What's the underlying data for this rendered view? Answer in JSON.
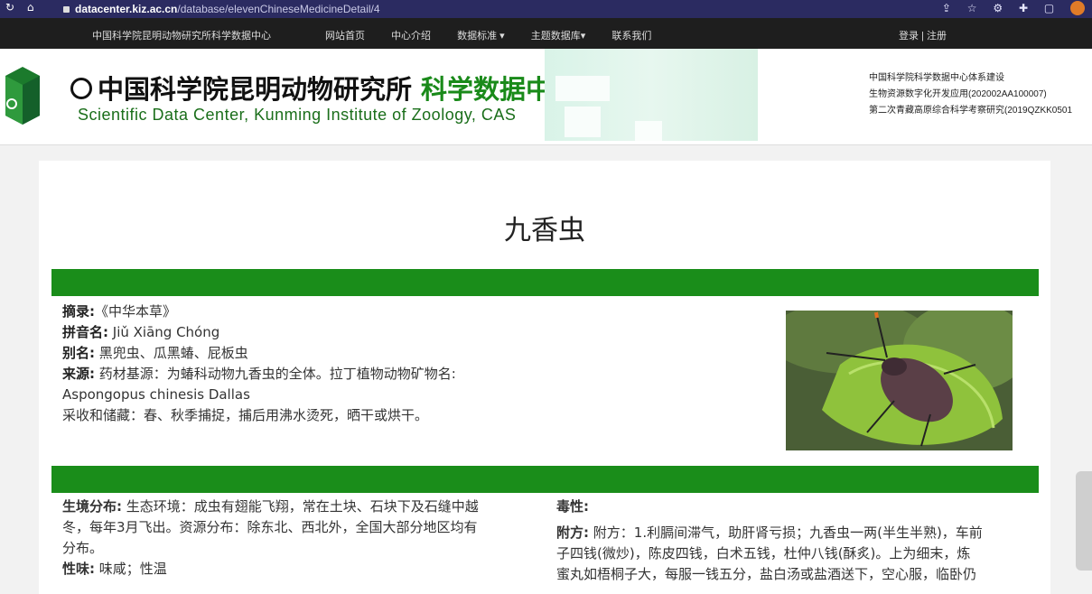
{
  "browser": {
    "host": "datacenter.kiz.ac.cn",
    "path": "/database/elevenChineseMedicineDetail/4"
  },
  "topnav": {
    "brand": "中国科学院昆明动物研究所科学数据中心",
    "items": [
      "网站首页",
      "中心介绍",
      "数据标准 ▾",
      "主题数据库▾",
      "联系我们"
    ],
    "login": "登录 | 注册"
  },
  "header": {
    "cn_title": "中国科学院昆明动物研究所",
    "cn_sub": "科学数据中心",
    "en_title": "Scientific Data Center, Kunming Institute of Zoology, CAS",
    "projects": [
      "中国科学院科学数据中心体系建设",
      "生物资源数字化开发应用(202002AA100007)",
      "第二次青藏高原综合科学考察研究(2019QZKK0501"
    ]
  },
  "record": {
    "title": "九香虫",
    "excerpt_label": "摘录:",
    "excerpt": "《中华本草》",
    "pinyin_label": "拼音名:",
    "pinyin": "Jiǔ Xiāng Chóng",
    "alias_label": "别名:",
    "alias": "黑兜虫、瓜黑蝽、屁板虫",
    "source_label": "来源:",
    "source_line1": "药材基源：为蝽科动物九香虫的全体。拉丁植物动物矿物名:",
    "source_line2": "Aspongopus chinesis Dallas",
    "source_line3": "采收和储藏：春、秋季捕捉，捕后用沸水烫死，晒干或烘干。",
    "habitat_label": "生境分布:",
    "habitat_line1": "生态环境：成虫有翅能飞翔，常在土块、石块下及石缝中越",
    "habitat_line2": "冬，每年3月飞出。资源分布：除东北、西北外，全国大部分地区均有",
    "habitat_line3": "分布。",
    "taste_label": "性味:",
    "taste": "味咸；性温",
    "toxicity_label": "毒性:",
    "formula_label": "附方:",
    "formula_line1": "附方：1.利膈间滞气，助肝肾亏损；九香虫一两(半生半熟)，车前",
    "formula_line2": "子四钱(微炒)，陈皮四钱，白术五钱，杜仲八钱(酥炙)。上为细末，炼",
    "formula_line3": "蜜丸如梧桐子大，每服一钱五分，盐白汤或盐酒送下，空心服，临卧仍"
  }
}
